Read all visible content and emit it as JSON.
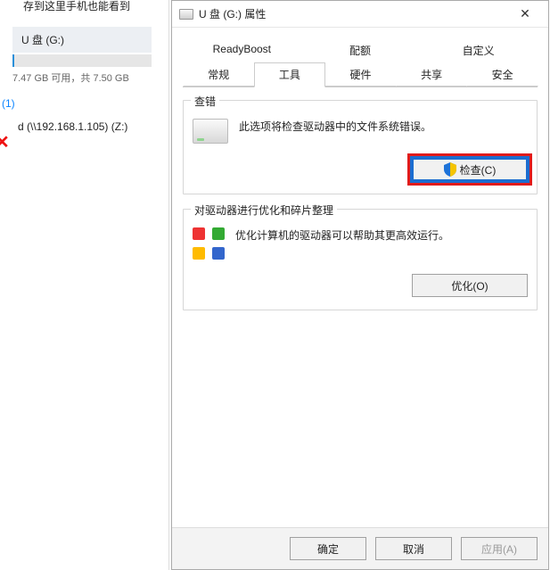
{
  "explorer": {
    "top_hint": "存到这里手机也能看到",
    "drive_label": "U 盘 (G:)",
    "drive_caption": "7.47 GB 可用，共 7.50 GB",
    "section_count": "(1)",
    "net_drive": "d (\\\\192.168.1.105) (Z:)"
  },
  "dialog": {
    "title": "U 盘 (G:) 属性",
    "tabs_upper": [
      "ReadyBoost",
      "配额",
      "自定义"
    ],
    "tabs_lower": [
      "常规",
      "工具",
      "硬件",
      "共享",
      "安全"
    ],
    "active_tab": "工具",
    "error_check": {
      "title": "查错",
      "desc": "此选项将检查驱动器中的文件系统错误。",
      "button": "检查(C)"
    },
    "defrag": {
      "title": "对驱动器进行优化和碎片整理",
      "desc": "优化计算机的驱动器可以帮助其更高效运行。",
      "button": "优化(O)"
    },
    "footer": {
      "ok": "确定",
      "cancel": "取消",
      "apply": "应用(A)"
    }
  }
}
